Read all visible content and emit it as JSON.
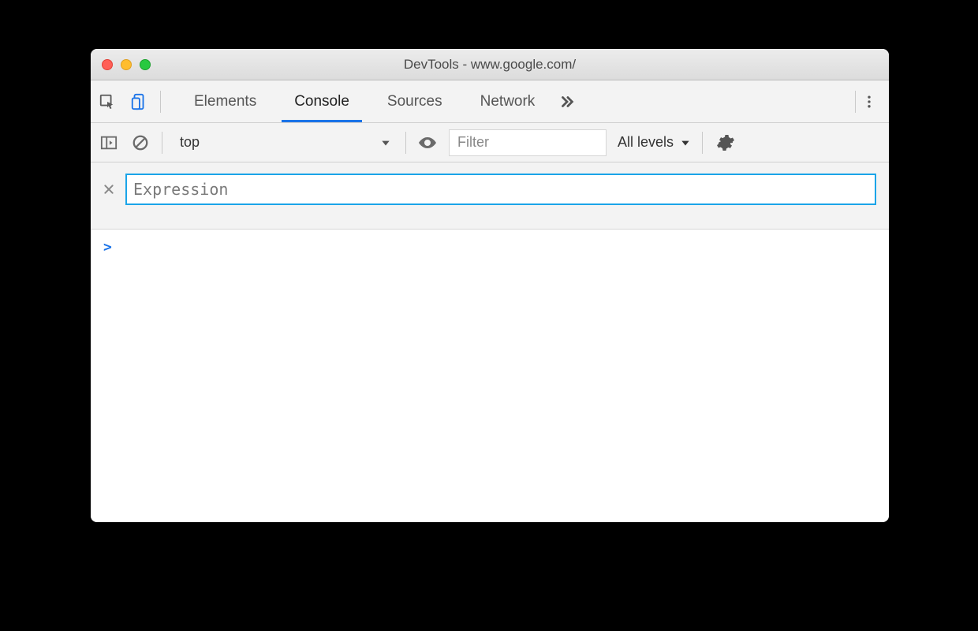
{
  "window": {
    "title": "DevTools - www.google.com/"
  },
  "tabs": {
    "items": [
      {
        "label": "Elements",
        "active": false
      },
      {
        "label": "Console",
        "active": true
      },
      {
        "label": "Sources",
        "active": false
      },
      {
        "label": "Network",
        "active": false
      }
    ]
  },
  "console_toolbar": {
    "context": "top",
    "filter_placeholder": "Filter",
    "levels_label": "All levels"
  },
  "expression": {
    "placeholder": "Expression",
    "value": ""
  },
  "prompt": {
    "caret": ">"
  },
  "icons": {
    "inspect": "inspect-element-icon",
    "device": "device-toolbar-icon",
    "more_tabs": "chevron-double-right-icon",
    "kebab": "kebab-menu-icon",
    "sidebar": "show-console-sidebar-icon",
    "clear": "clear-console-icon",
    "eye": "live-expression-eye-icon",
    "caret_down": "caret-down-icon",
    "gear": "settings-gear-icon",
    "close": "close-icon"
  }
}
